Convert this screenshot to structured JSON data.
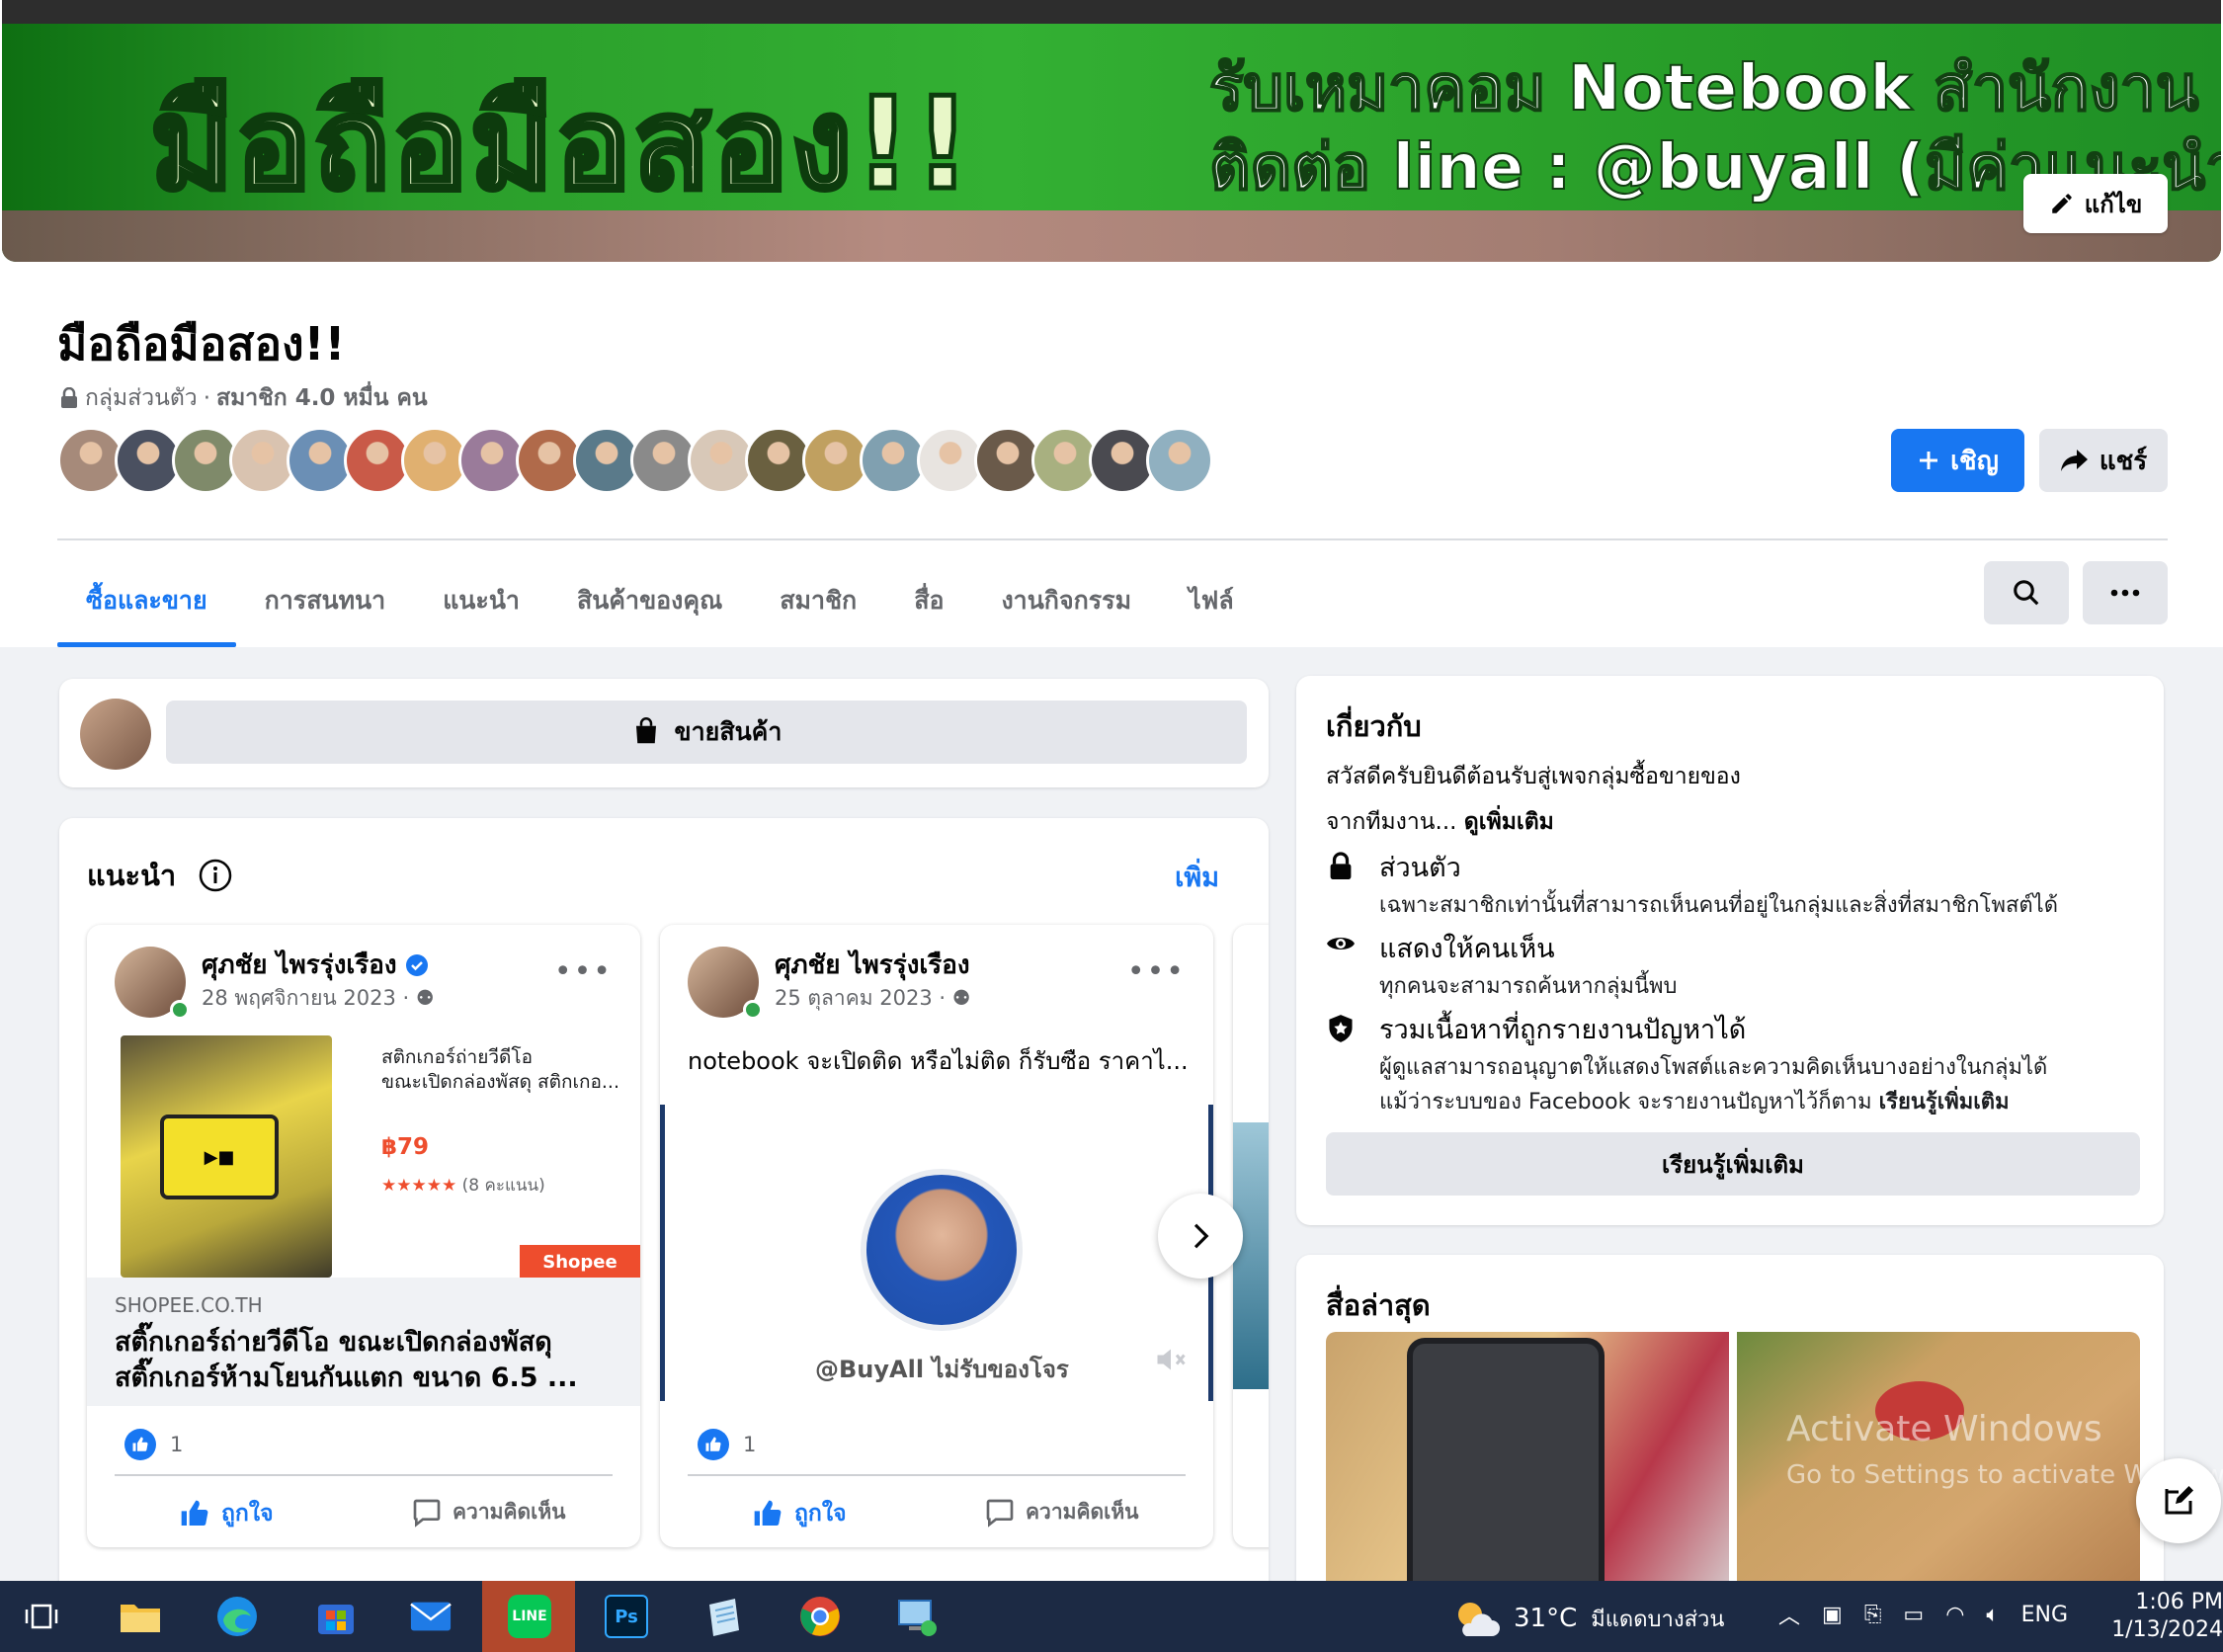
{
  "cover": {
    "title": "มือถือมือสอง!!",
    "line1": "รับเหมาคอม Notebook สำนักงาน",
    "line2": "ติดต่อ line : @buyall (มีค่าแนะนำ)",
    "edit_label": "แก้ไข"
  },
  "group": {
    "name": "มือถือมือสอง!!",
    "privacy": "กลุ่มส่วนตัว",
    "separator": "·",
    "members": "สมาชิก 4.0 หมื่น คน",
    "member_avatar_count": 20
  },
  "actions": {
    "invite_label": "เชิญ",
    "share_label": "แชร์"
  },
  "tabs": [
    {
      "label": "ซื้อและขาย",
      "active": true
    },
    {
      "label": "การสนทนา",
      "active": false
    },
    {
      "label": "แนะนำ",
      "active": false
    },
    {
      "label": "สินค้าของคุณ",
      "active": false
    },
    {
      "label": "สมาชิก",
      "active": false
    },
    {
      "label": "สื่อ",
      "active": false
    },
    {
      "label": "งานกิจกรรม",
      "active": false
    },
    {
      "label": "ไฟล์",
      "active": false
    }
  ],
  "sell": {
    "button_label": "ขายสินค้า"
  },
  "recommended": {
    "title": "แนะนำ",
    "more_label": "เพิ่ม",
    "posts": [
      {
        "author": "ศุภชัย ไพรรุ่งเรือง",
        "verified": true,
        "date": "28 พฤศจิกายน 2023 · ",
        "link": {
          "desc_line1": "สติกเกอร์ถ่ายวีดีโอ",
          "desc_line2": "ขณะเปิดกล่องพัสดุ สติกเกอ...",
          "price": "฿79",
          "stars": "★★★★★",
          "rating": "(8 คะแนน)",
          "shop": "Shopee",
          "domain": "SHOPEE.CO.TH",
          "title_line1": "สติ๊กเกอร์ถ่ายวีดีโอ ขณะเปิดกล่องพัสดุ",
          "title_line2": "สติ๊กเกอร์ห้ามโยนกันแตก ขนาด 6.5 ..."
        },
        "likes": "1",
        "like_label": "ถูกใจ",
        "comment_label": "ความคิดเห็น"
      },
      {
        "author": "ศุภชัย ไพรรุ่งเรือง",
        "verified": false,
        "date": "25 ตุลาคม 2023 · ",
        "text": "notebook จะเปิดติด หรือไม่ติด ก็รับซือ ราคาไ...",
        "video_caption": "@BuyAll ไม่รับของโจร",
        "likes": "1",
        "like_label": "ถูกใจ",
        "comment_label": "ความคิดเห็น"
      }
    ]
  },
  "about": {
    "title": "เกี่ยวกับ",
    "desc_line1": "สวัสดีครับยินดีต้อนรับสู่เพจกลุ่มซื้อขายของ",
    "desc_line2": "จากทีมงาน... ",
    "see_more": "ดูเพิ่มเติม",
    "items": [
      {
        "title": "ส่วนตัว",
        "desc": "เฉพาะสมาชิกเท่านั้นที่สามารถเห็นคนที่อยู่ในกลุ่มและสิ่งที่สมาชิกโพสต์ได้"
      },
      {
        "title": "แสดงให้คนเห็น",
        "desc": "ทุกคนจะสามารถค้นหากลุ่มนี้พบ"
      },
      {
        "title": "รวมเนื้อหาที่ถูกรายงานปัญหาได้",
        "desc": "ผู้ดูแลสามารถอนุญาตให้แสดงโพสต์และความคิดเห็นบางอย่างในกลุ่มได้",
        "desc2": "แม้ว่าระบบของ Facebook จะรายงานปัญหาไว้ก็ตาม ",
        "link": "เรียนรู้เพิ่มเติม"
      }
    ],
    "learn_more_label": "เรียนรู้เพิ่มเติม"
  },
  "media": {
    "title": "สื่อล่าสุด"
  },
  "watermark": {
    "line1": "Activate Windows",
    "line2": "Go to Settings to activate Windows."
  },
  "taskbar": {
    "apps": [
      "task-view",
      "file-explorer",
      "edge",
      "store",
      "mail",
      "line",
      "photoshop",
      "notepad",
      "chrome",
      "remote-desktop"
    ],
    "line_label": "LINE",
    "ps_label": "Ps",
    "temperature": "31°C",
    "weather": "มีแดดบางส่วน",
    "language": "ENG",
    "time": "1:06 PM",
    "date": "1/13/2024"
  },
  "colors": {
    "accent": "#1877f2",
    "background": "#f0f2f5",
    "taskbar": "#1c2a44"
  }
}
